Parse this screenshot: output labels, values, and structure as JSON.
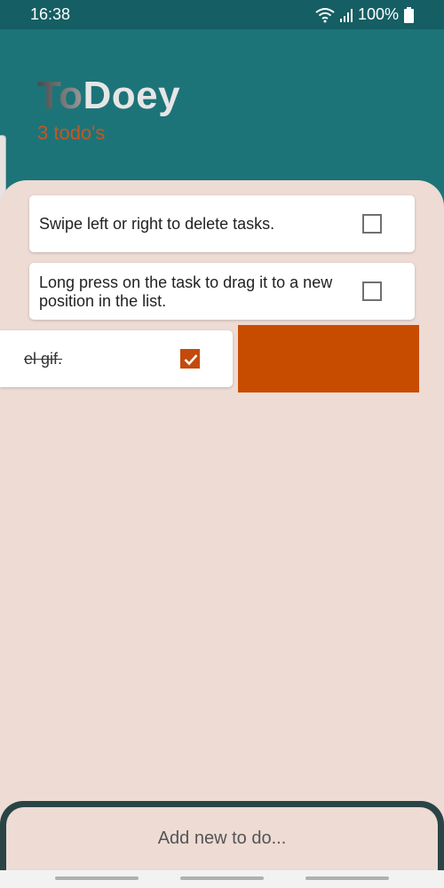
{
  "status_bar": {
    "time": "16:38",
    "battery": "100%",
    "icons": [
      "wifi-icon",
      "signal-icon",
      "battery-icon"
    ]
  },
  "header": {
    "title_part1": "To",
    "title_part2": "Doey",
    "todo_count": "3 todo's"
  },
  "tasks": [
    {
      "text": "Swipe left or right to delete tasks.",
      "checked": false
    },
    {
      "text": "Long press on the task to drag it to a new position in the list.",
      "checked": false
    },
    {
      "text": "el gif.",
      "checked": true
    }
  ],
  "add_task": {
    "placeholder": "Add new to do..."
  },
  "colors": {
    "header": "#1c7479",
    "status_bar": "#155e63",
    "background": "#eddbd4",
    "accent": "#c44a0c",
    "delete_swipe": "#c84c00",
    "bottom_bar": "#2a4446"
  }
}
